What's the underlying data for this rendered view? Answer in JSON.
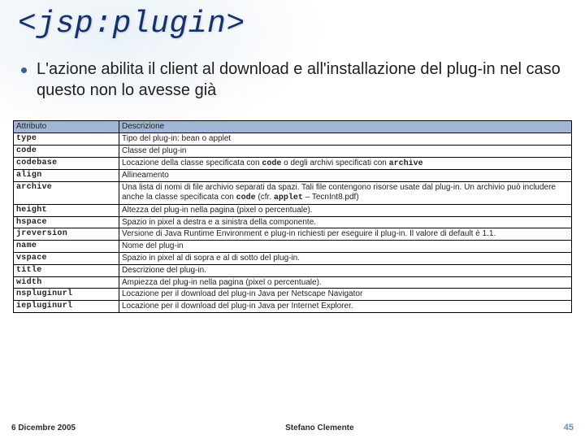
{
  "title": "<jsp:plugin>",
  "bullet_text": "L'azione abilita il client al download e all'installazione del plug-in nel caso questo non lo avesse già",
  "table": {
    "header_attr": "Attributo",
    "header_desc": "Descrizione",
    "rows": [
      {
        "attr": "type",
        "desc_html": "Tipo del plug-in: bean o applet"
      },
      {
        "attr": "code",
        "desc_html": "Classe del plug-in"
      },
      {
        "attr": "codebase",
        "desc_html": "Locazione della classe specificata con <span class=\"mono\">code</span> o degli archivi specificati con <span class=\"mono\">archive</span>"
      },
      {
        "attr": "align",
        "desc_html": "Allineamento"
      },
      {
        "attr": "archive",
        "desc_html": "Una lista di nomi di file archivio separati da spazi. Tali file contengono risorse usate dal plug-in. Un archivio può includere anche la classe specificata con <span class=\"mono\">code</span> (cfr. <span class=\"mono\">applet</span> – TecnInt8.pdf)"
      },
      {
        "attr": "height",
        "desc_html": "Altezza del plug-in nella pagina (pixel o percentuale)."
      },
      {
        "attr": "hspace",
        "desc_html": "Spazio in pixel a destra e a sinistra della componente."
      },
      {
        "attr": "jreversion",
        "desc_html": "Versione di Java Runtime Environment e plug-in richiesti per eseguire il plug-in. Il valore di default è 1.1."
      },
      {
        "attr": "name",
        "desc_html": "Nome del plug-in"
      },
      {
        "attr": "vspace",
        "desc_html": "Spazio in pixel al di sopra e al di sotto del plug-in."
      },
      {
        "attr": "title",
        "desc_html": "Descrizione del plug-in."
      },
      {
        "attr": "width",
        "desc_html": "Ampiezza del plug-in nella pagina (pixel o percentuale)."
      },
      {
        "attr": "nspluginurl",
        "desc_html": "Locazione per il download del plug-in Java per Netscape Navigator"
      },
      {
        "attr": "iepluginurl",
        "desc_html": "Locazione per il download del plug-in Java per Internet Explorer."
      }
    ]
  },
  "footer": {
    "date": "6 Dicembre 2005",
    "author": "Stefano Clemente",
    "page": "45"
  }
}
